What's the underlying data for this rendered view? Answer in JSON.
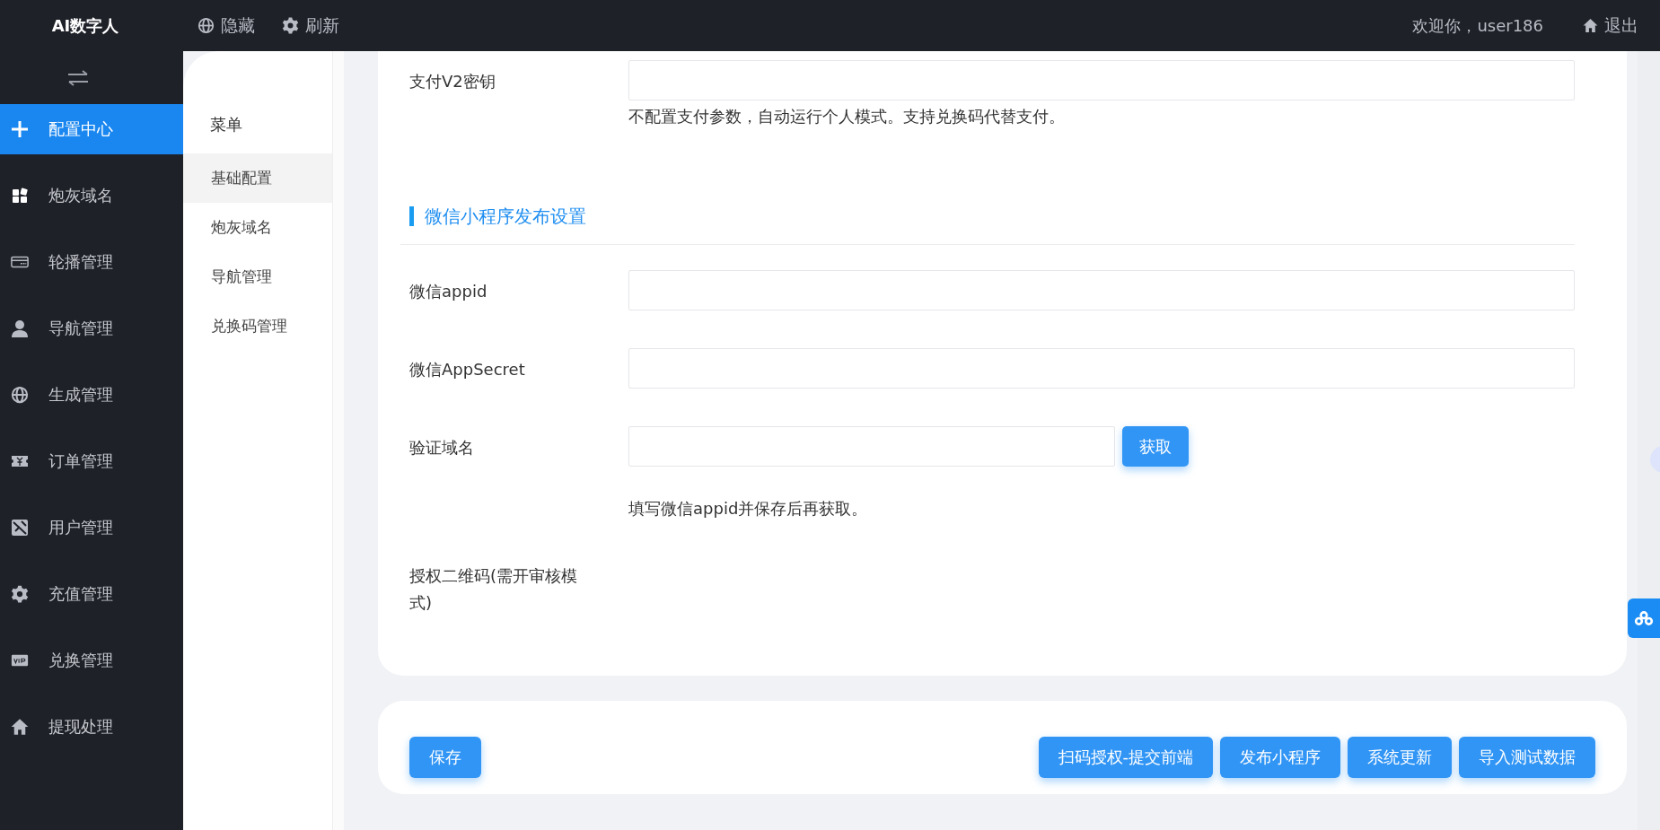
{
  "header": {
    "brand": "AI数字人",
    "actions": [
      {
        "label": "隐藏"
      },
      {
        "label": "刷新"
      }
    ],
    "welcome": "欢迎你，user186",
    "logout": "退出"
  },
  "sidebar": {
    "items": [
      {
        "label": "配置中心",
        "selected": true
      },
      {
        "label": "炮灰域名",
        "selected": false
      },
      {
        "label": "轮播管理",
        "selected": false
      },
      {
        "label": "导航管理",
        "selected": false
      },
      {
        "label": "生成管理",
        "selected": false
      },
      {
        "label": "订单管理",
        "selected": false
      },
      {
        "label": "用户管理",
        "selected": false
      },
      {
        "label": "充值管理",
        "selected": false
      },
      {
        "label": "兑换管理",
        "selected": false
      },
      {
        "label": "提现处理",
        "selected": false
      }
    ]
  },
  "submenu": {
    "title": "菜单",
    "items": [
      {
        "label": "基础配置",
        "selected": true
      },
      {
        "label": "炮灰域名",
        "selected": false
      },
      {
        "label": "导航管理",
        "selected": false
      },
      {
        "label": "兑换码管理",
        "selected": false
      }
    ]
  },
  "form": {
    "rows": [
      {
        "kind": "field",
        "label": "支付V2密钥",
        "help": "不配置支付参数，自动运行个人模式。支持兑换码代替支付。"
      },
      {
        "kind": "section",
        "title": "微信小程序发布设置"
      },
      {
        "kind": "field",
        "label": "微信appid"
      },
      {
        "kind": "field",
        "label": "微信AppSecret"
      },
      {
        "kind": "field_button",
        "label": "验证域名",
        "button": "获取",
        "help": "填写微信appid并保存后再获取。"
      },
      {
        "kind": "label",
        "label": "授权二维码(需开审核模式)"
      }
    ]
  },
  "actions": {
    "left": "保存",
    "right": [
      "扫码授权-提交前端",
      "发布小程序",
      "系统更新",
      "导入测试数据"
    ]
  }
}
